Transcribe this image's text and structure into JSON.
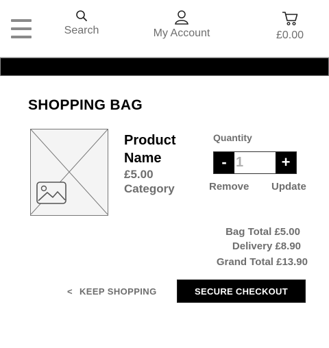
{
  "header": {
    "menu_icon": "hamburger-icon",
    "search": {
      "icon": "search-icon",
      "label": "Search"
    },
    "account": {
      "icon": "user-icon",
      "label": "My Account"
    },
    "cart": {
      "icon": "cart-icon",
      "total": "£0.00"
    }
  },
  "page": {
    "title": "SHOPPING BAG"
  },
  "cart_item": {
    "image_icon": "image-placeholder-icon",
    "name": "Product Name",
    "price": "£5.00",
    "category": "Category",
    "quantity_label": "Quantity",
    "minus_label": "-",
    "plus_label": "+",
    "quantity_value": "1",
    "remove_label": "Remove",
    "update_label": "Update"
  },
  "totals": {
    "bag_total": "Bag Total £5.00",
    "delivery": "Delivery £8.90",
    "grand_total": "Grand Total £13.90"
  },
  "actions": {
    "keep_shopping_chevron": "<",
    "keep_shopping": "KEEP SHOPPING",
    "checkout": "SECURE CHECKOUT"
  },
  "colors": {
    "accent": "#000000",
    "muted_text": "#6e6e6e",
    "background": "#ffffff"
  }
}
